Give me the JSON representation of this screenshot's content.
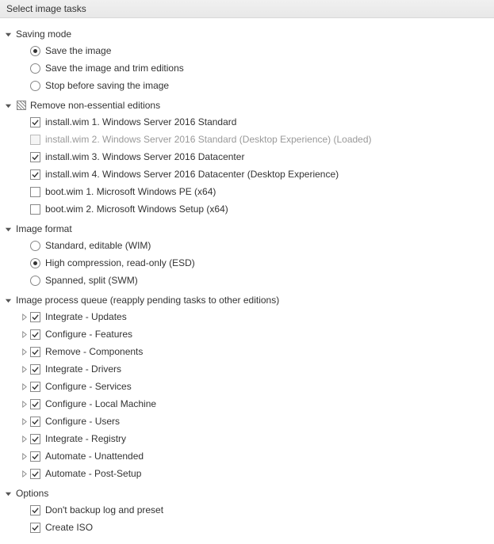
{
  "header": {
    "title": "Select image tasks"
  },
  "sections": [
    {
      "id": "saving-mode",
      "label": "Saving mode",
      "expanded": true,
      "type": "radio",
      "items": [
        {
          "label": "Save the image",
          "selected": true
        },
        {
          "label": "Save the image and trim editions",
          "selected": false
        },
        {
          "label": "Stop before saving the image",
          "selected": false
        }
      ]
    },
    {
      "id": "remove-editions",
      "label": "Remove non-essential editions",
      "expanded": true,
      "type": "checkbox",
      "icon": "hatch",
      "items": [
        {
          "label": "install.wim 1. Windows Server 2016 Standard",
          "checked": true,
          "disabled": false
        },
        {
          "label": "install.wim 2. Windows Server 2016 Standard (Desktop Experience)  (Loaded)",
          "checked": false,
          "disabled": true
        },
        {
          "label": "install.wim 3. Windows Server 2016 Datacenter",
          "checked": true,
          "disabled": false
        },
        {
          "label": "install.wim 4. Windows Server 2016 Datacenter (Desktop Experience)",
          "checked": true,
          "disabled": false
        },
        {
          "label": "boot.wim 1. Microsoft Windows PE (x64)",
          "checked": false,
          "disabled": false
        },
        {
          "label": "boot.wim 2. Microsoft Windows Setup (x64)",
          "checked": false,
          "disabled": false
        }
      ]
    },
    {
      "id": "image-format",
      "label": "Image format",
      "expanded": true,
      "type": "radio",
      "items": [
        {
          "label": "Standard, editable (WIM)",
          "selected": false
        },
        {
          "label": "High compression, read-only (ESD)",
          "selected": true
        },
        {
          "label": "Spanned, split (SWM)",
          "selected": false
        }
      ]
    },
    {
      "id": "process-queue",
      "label": "Image process queue (reapply pending tasks to other editions)",
      "expanded": true,
      "type": "checkbox-expandable",
      "items": [
        {
          "label": "Integrate - Updates",
          "checked": true
        },
        {
          "label": "Configure - Features",
          "checked": true
        },
        {
          "label": "Remove - Components",
          "checked": true
        },
        {
          "label": "Integrate - Drivers",
          "checked": true
        },
        {
          "label": "Configure - Services",
          "checked": true
        },
        {
          "label": "Configure - Local Machine",
          "checked": true
        },
        {
          "label": "Configure - Users",
          "checked": true
        },
        {
          "label": "Integrate - Registry",
          "checked": true
        },
        {
          "label": "Automate - Unattended",
          "checked": true
        },
        {
          "label": "Automate - Post-Setup",
          "checked": true
        }
      ]
    },
    {
      "id": "options",
      "label": "Options",
      "expanded": true,
      "type": "checkbox",
      "items": [
        {
          "label": "Don't backup log and preset",
          "checked": true
        },
        {
          "label": "Create ISO",
          "checked": true
        }
      ]
    }
  ]
}
